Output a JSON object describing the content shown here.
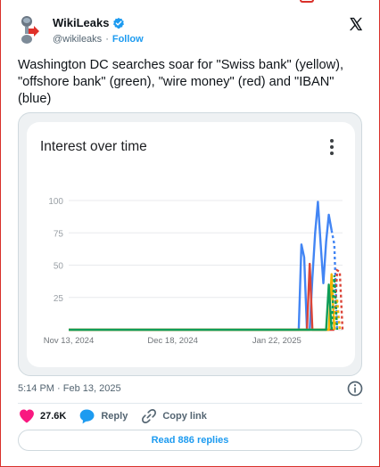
{
  "account": {
    "display_name": "WikiLeaks",
    "handle": "@wikileaks",
    "separator": "·",
    "follow_label": "Follow",
    "verified_color": "#1d9bf0"
  },
  "tweet": {
    "text": "Washington DC searches soar for \"Swiss bank\" (yellow), \"offshore bank\" (green), \"wire money\" (red) and \"IBAN\" (blue)",
    "timestamp": "5:14 PM · Feb 13, 2025"
  },
  "media": {
    "card_title": "Interest over time",
    "menu_icon": "more-vert-icon"
  },
  "chart_data": {
    "type": "line",
    "title": "Interest over time",
    "y_ticks": [
      100,
      75,
      50,
      25
    ],
    "ylim": [
      0,
      100
    ],
    "x_tick_labels": [
      "Nov 13, 2024",
      "Dec 18, 2024",
      "Jan 22, 2025"
    ],
    "grid": true,
    "x_index_range": [
      0,
      100
    ],
    "x_tick_positions": [
      0,
      38,
      76
    ],
    "series": [
      {
        "color": "#4285f4",
        "points": [
          [
            0,
            0
          ],
          [
            84,
            0
          ],
          [
            85,
            66
          ],
          [
            86,
            56
          ],
          [
            87,
            0
          ],
          [
            88,
            0
          ],
          [
            89,
            40
          ],
          [
            90,
            75
          ],
          [
            91,
            99
          ],
          [
            92,
            67
          ],
          [
            93,
            36
          ],
          [
            94,
            68
          ],
          [
            95,
            89
          ],
          [
            96,
            77
          ]
        ],
        "dashed_tail": [
          [
            96,
            77
          ],
          [
            97,
            66
          ],
          [
            98,
            0
          ]
        ]
      },
      {
        "color": "#db4437",
        "points": [
          [
            0,
            0
          ],
          [
            87,
            0
          ],
          [
            88,
            51
          ],
          [
            89,
            0
          ],
          [
            96,
            0
          ],
          [
            97,
            0
          ]
        ],
        "dashed_tail": [
          [
            97,
            0
          ],
          [
            98,
            46
          ],
          [
            99,
            45
          ],
          [
            100,
            0
          ]
        ]
      },
      {
        "color": "#f4b400",
        "points": [
          [
            0,
            0
          ],
          [
            95,
            0
          ],
          [
            96,
            43
          ],
          [
            97,
            0
          ]
        ],
        "dashed_tail": [
          [
            97,
            0
          ],
          [
            98,
            24
          ],
          [
            99,
            0
          ]
        ]
      },
      {
        "color": "#0f9d58",
        "points": [
          [
            0,
            0
          ],
          [
            94,
            0
          ],
          [
            95,
            35
          ],
          [
            96,
            0
          ]
        ],
        "dashed_tail": [
          [
            96,
            0
          ],
          [
            97,
            42
          ],
          [
            98,
            0
          ]
        ]
      }
    ]
  },
  "engagement": {
    "likes": "27.6K",
    "reply_label": "Reply",
    "copy_label": "Copy link",
    "like_color": "#f91880"
  },
  "replies_button": {
    "label": "Read 886 replies"
  }
}
